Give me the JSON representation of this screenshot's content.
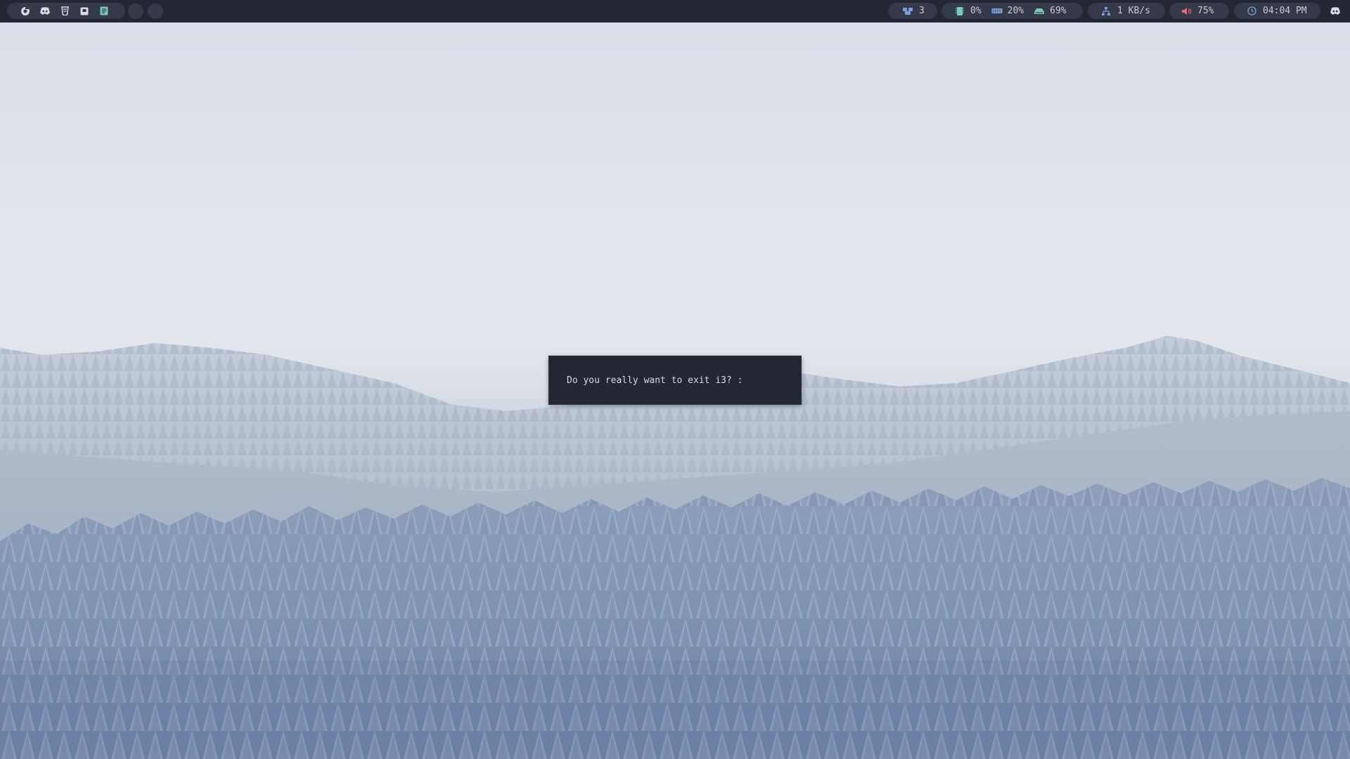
{
  "topbar": {
    "workspaces": [
      {
        "icon": "chrome-icon"
      },
      {
        "icon": "discord-icon"
      },
      {
        "icon": "code-editor-icon"
      },
      {
        "icon": "notes-icon"
      },
      {
        "icon": "document-icon"
      }
    ],
    "status": {
      "windows": {
        "icon": "window-stack-icon",
        "value": "3"
      },
      "cpu": {
        "icon": "cpu-icon",
        "value": "0%"
      },
      "memory": {
        "icon": "memory-icon",
        "value": "20%"
      },
      "disk": {
        "icon": "disk-icon",
        "value": "69%"
      },
      "network": {
        "icon": "network-icon",
        "value": "1 KB/s"
      },
      "volume": {
        "icon": "volume-icon",
        "value": "75%"
      },
      "clock": {
        "icon": "clock-icon",
        "value": "04:04 PM"
      }
    },
    "tray": {
      "icon": "discord-tray-icon"
    }
  },
  "dialog": {
    "prompt": "Do you really want to exit i3? :"
  },
  "colors": {
    "bar_bg": "#232733",
    "pill_bg": "#353a48",
    "text": "#c8ccd6",
    "icon_blue": "#7aa2e3",
    "icon_teal": "#79c7b7",
    "icon_red": "#e06c75"
  }
}
